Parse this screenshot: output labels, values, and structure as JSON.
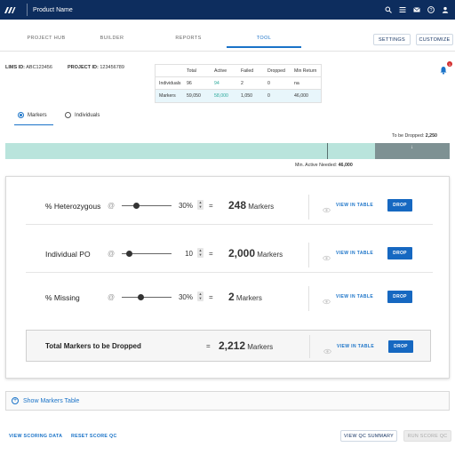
{
  "appbar": {
    "product_name": "Product Name",
    "icons": [
      "search-icon",
      "list-icon",
      "mail-icon",
      "help-icon",
      "user-icon"
    ]
  },
  "nav": {
    "tabs": [
      {
        "label": "PROJECT HUB"
      },
      {
        "label": "BUILDER"
      },
      {
        "label": "REPORTS"
      },
      {
        "label": "TOOL"
      }
    ],
    "active_tab": "TOOL",
    "settings": "SETTINGS",
    "customize": "CUSTOMIZE"
  },
  "project": {
    "lims_label": "LIMS ID:",
    "lims_value": "ABC123456",
    "project_label": "PROJECT ID:",
    "project_value": "123456789"
  },
  "notifications": {
    "count": "1"
  },
  "summary_table": {
    "headers": [
      "",
      "Total",
      "Active",
      "Failed",
      "Dropped",
      "Min Return"
    ],
    "rows": [
      {
        "name": "Individuals",
        "total": "96",
        "active": "94",
        "failed": "2",
        "dropped": "0",
        "min_return": "na"
      },
      {
        "name": "Markers",
        "total": "59,050",
        "active": "58,000",
        "failed": "1,050",
        "dropped": "0",
        "min_return": "46,000"
      }
    ]
  },
  "view_toggle": {
    "markers": "Markers",
    "individuals": "Individuals",
    "selected": "Markers"
  },
  "drop_bar": {
    "to_be_dropped_label": "To be Dropped:",
    "to_be_dropped_value": "2,250",
    "min_active_label": "Min. Active Needed:",
    "min_active_value": "46,000"
  },
  "qc_filters": [
    {
      "label": "% Heterozygous",
      "at": "@",
      "value": "30%",
      "level_pct": 30,
      "count": "248",
      "unit": "Markers",
      "view": "VIEW IN TABLE",
      "drop": "DROP"
    },
    {
      "label": "Individual PO",
      "at": "@",
      "value": "10",
      "level_pct": 15,
      "count": "2,000",
      "unit": "Markers",
      "view": "VIEW IN TABLE",
      "drop": "DROP"
    },
    {
      "label": "% Missing",
      "at": "@",
      "value": "30%",
      "level_pct": 38,
      "count": "2",
      "unit": "Markers",
      "view": "VIEW IN TABLE",
      "drop": "DROP"
    }
  ],
  "total": {
    "label": "Total Markers to be Dropped",
    "count": "2,212",
    "unit": "Markers",
    "view": "VIEW IN TABLE",
    "drop": "DROP"
  },
  "show_table": "Show Markers Table",
  "footer": {
    "view_scoring_data": "VIEW SCORING DATA",
    "reset_score_qc": "RESET SCORE QC",
    "view_qc_summary": "VIEW QC SUMMARY",
    "run_score_qc": "RUN SCORE QC"
  },
  "colors": {
    "appbar": "#0d2d5e",
    "accent": "#1a73c8",
    "bar_active": "#b9e4dc",
    "bar_drop": "#7e9193",
    "active_value": "#2aa89a"
  }
}
